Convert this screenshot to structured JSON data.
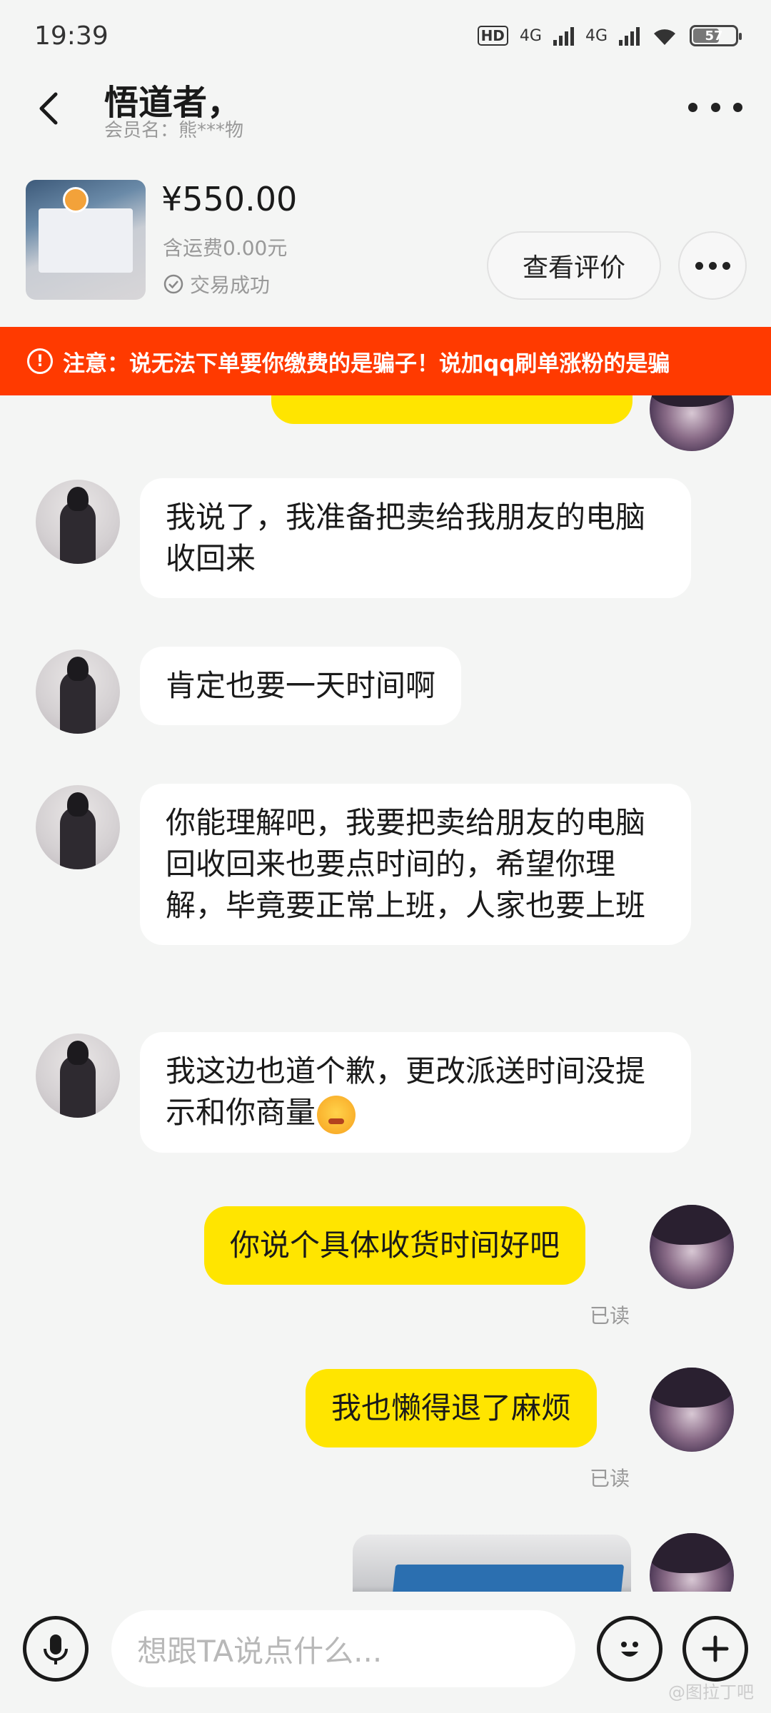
{
  "status_bar": {
    "time": "19:39",
    "hd_label": "HD",
    "net1": "4G",
    "net2": "4G",
    "battery": "57"
  },
  "header": {
    "title": "悟道者，",
    "member_label": "会员名：熊***物"
  },
  "product": {
    "price": "¥550.00",
    "shipping": "含运费0.00元",
    "status": "交易成功",
    "review_button": "查看评价"
  },
  "warning": {
    "text": "注意：说无法下单要你缴费的是骗子！说加qq刷单涨粉的是骗"
  },
  "messages": [
    {
      "sender": "other",
      "text": "我说了，我准备把卖给我朋友的电脑收回来"
    },
    {
      "sender": "other",
      "text": "肯定也要一天时间啊"
    },
    {
      "sender": "other",
      "text": "你能理解吧，我要把卖给朋友的电脑回收回来也要点时间的，希望你理解，毕竟要正常上班，人家也要上班"
    },
    {
      "sender": "other",
      "text": "我这边也道个歉，更改派送时间没提示和你商量",
      "emoji": "grimacing-face"
    },
    {
      "sender": "me",
      "text": "你说个具体收货时间好吧",
      "read": "已读"
    },
    {
      "sender": "me",
      "text": "我也懒得退了麻烦",
      "read": "已读"
    }
  ],
  "input": {
    "placeholder": "想跟TA说点什么..."
  },
  "watermark": "@图拉丁吧",
  "colors": {
    "accent_yellow": "#ffe500",
    "warning_red": "#ff3a00"
  }
}
